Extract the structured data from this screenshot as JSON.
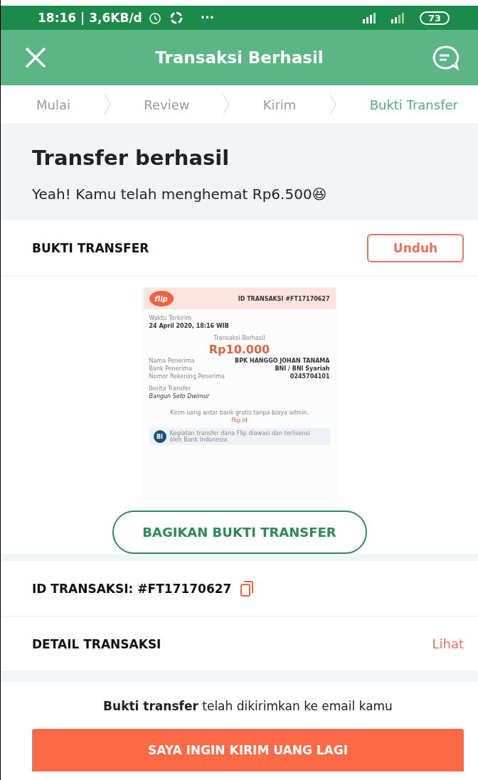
{
  "status_bar": {
    "time": "18:16 | 3,6KB/d",
    "more": "···",
    "battery": "73"
  },
  "header": {
    "title": "Transaksi Berhasil"
  },
  "steps": [
    {
      "label": "Mulai",
      "selected": false
    },
    {
      "label": "Review",
      "selected": false
    },
    {
      "label": "Kirim",
      "selected": false
    },
    {
      "label": "Bukti Transfer",
      "selected": true
    }
  ],
  "hero": {
    "title": "Transfer berhasil",
    "message": "Yeah! Kamu telah menghemat  Rp6.500😆"
  },
  "proof": {
    "title": "BUKTI TRANSFER",
    "download": "Unduh",
    "receipt": {
      "logo": "flip",
      "id": "ID TRANSAKSI #FT17170627",
      "time_label": "Waktu Terkirim",
      "time": "24 April 2020, 18:16 WIB",
      "status": "Transaksi Berhasil",
      "amount": "Rp10.000",
      "rows": [
        {
          "label": "Nama Penerima",
          "value": "BPK HANGGO JOHAN TANAMA"
        },
        {
          "label": "Bank Penerima",
          "value": "BNI / BNI Syariah"
        },
        {
          "label": "Nomor Rekening Penerima",
          "value": "0245704101"
        }
      ],
      "note_label": "Berita Transfer",
      "note": "Bangun Seto Dwimur",
      "promo": "Kirim uang antar bank gratis tanpa biaya admin.",
      "link": "flip.id",
      "bi_logo": "BI",
      "bi_text": "Kegiatan transfer dana Flip diawasi dan terlisensi oleh Bank Indonesia"
    },
    "share": "BAGIKAN BUKTI TRANSFER"
  },
  "transaction_id": "ID TRANSAKSI: #FT17170627",
  "detail": {
    "title": "DETAIL TRANSAKSI",
    "action": "Lihat"
  },
  "footer": {
    "message": "**Bukti transfer** telah dikirimkan ke email kamu",
    "button": "SAYA INGIN KIRIM UANG LAGI"
  }
}
